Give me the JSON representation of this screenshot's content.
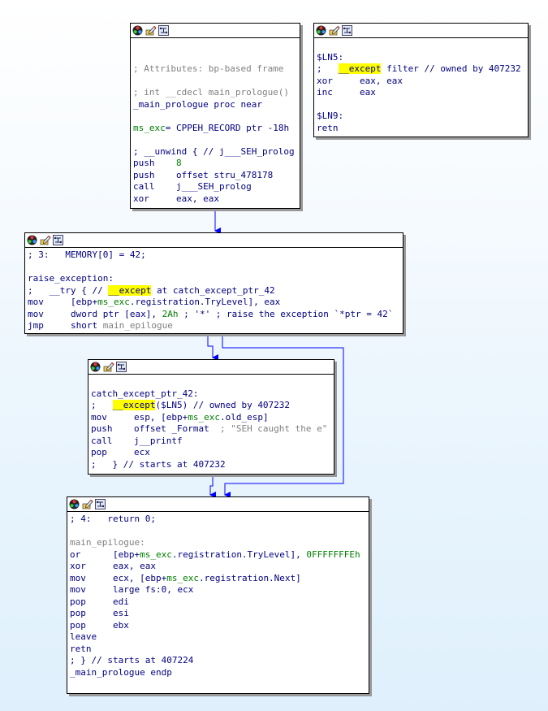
{
  "node_header_icons": [
    "graph-colors-icon",
    "edit-node-icon",
    "node-layout-icon"
  ],
  "colors": {
    "edge": "#0000ff",
    "highlight": "#ffff00",
    "name": "#000080",
    "comment": "#808080",
    "number": "#008000"
  },
  "nodes": [
    {
      "id": "main_prologue",
      "lines": [
        [],
        [],
        [
          {
            "t": "; Attributes: bp-based frame",
            "c": "g"
          }
        ],
        [],
        [
          {
            "t": "; int __cdecl main_prologue()",
            "c": "g"
          }
        ],
        [
          {
            "t": "_main_prologue proc near",
            "c": "nv"
          }
        ],
        [],
        [
          {
            "t": "ms_exc",
            "c": "gr"
          },
          {
            "t": "= CPPEH_RECORD ptr -18h",
            "c": "nv"
          }
        ],
        [],
        [
          {
            "t": "; __unwind { // j___SEH_prolog",
            "c": "nv"
          }
        ],
        [
          {
            "t": "push    ",
            "c": "nv"
          },
          {
            "t": "8",
            "c": "gr"
          }
        ],
        [
          {
            "t": "push    offset stru_478178",
            "c": "nv"
          }
        ],
        [
          {
            "t": "call    j___SEH_prolog",
            "c": "nv"
          }
        ],
        [
          {
            "t": "xor     eax, eax",
            "c": "nv"
          }
        ]
      ]
    },
    {
      "id": "ln5_filter",
      "lines": [
        [],
        [
          {
            "t": "$LN5:",
            "c": "nv"
          }
        ],
        [
          {
            "t": ";   ",
            "c": "nv"
          },
          {
            "t": "__except",
            "c": "hl"
          },
          {
            "t": " filter // owned by 407232",
            "c": "nv"
          }
        ],
        [
          {
            "t": "xor     eax, eax",
            "c": "nv"
          }
        ],
        [
          {
            "t": "inc     eax",
            "c": "nv"
          }
        ],
        [],
        [
          {
            "t": "$LN9:",
            "c": "nv"
          }
        ],
        [
          {
            "t": "retn",
            "c": "nv"
          }
        ]
      ]
    },
    {
      "id": "raise_exception",
      "lines": [
        [
          {
            "t": "; 3:   MEMORY[0] = 42;",
            "c": "nv"
          }
        ],
        [],
        [
          {
            "t": "raise_exception:",
            "c": "nv"
          }
        ],
        [
          {
            "t": ";   __try { // ",
            "c": "nv"
          },
          {
            "t": "__except",
            "c": "hl"
          },
          {
            "t": " at catch_except_ptr_42",
            "c": "nv"
          }
        ],
        [
          {
            "t": "mov     [ebp+",
            "c": "nv"
          },
          {
            "t": "ms_exc",
            "c": "gr"
          },
          {
            "t": ".registration.TryLevel], eax",
            "c": "nv"
          }
        ],
        [
          {
            "t": "mov     dword ptr [eax], ",
            "c": "nv"
          },
          {
            "t": "2Ah",
            "c": "gr"
          },
          {
            "t": " ; '*' ; raise the exception `*ptr = 42`",
            "c": "nv"
          }
        ],
        [
          {
            "t": "jmp     short ",
            "c": "nv"
          },
          {
            "t": "main_epilogue",
            "c": "g"
          }
        ]
      ]
    },
    {
      "id": "catch_except_ptr_42",
      "lines": [
        [],
        [
          {
            "t": "catch_except_ptr_42:",
            "c": "nv"
          }
        ],
        [
          {
            "t": ";   ",
            "c": "nv"
          },
          {
            "t": "__except",
            "c": "hl"
          },
          {
            "t": "($LN5) // owned by 407232",
            "c": "nv"
          }
        ],
        [
          {
            "t": "mov     esp, [ebp+",
            "c": "nv"
          },
          {
            "t": "ms_exc",
            "c": "gr"
          },
          {
            "t": ".old_esp]",
            "c": "nv"
          }
        ],
        [
          {
            "t": "push    offset _Format  ",
            "c": "nv"
          },
          {
            "t": "; \"SEH caught the e\"",
            "c": "g"
          }
        ],
        [
          {
            "t": "call    j__printf",
            "c": "nv"
          }
        ],
        [
          {
            "t": "pop     ecx",
            "c": "nv"
          }
        ],
        [
          {
            "t": ";   } // starts at 407232",
            "c": "nv"
          }
        ]
      ]
    },
    {
      "id": "main_epilogue",
      "lines": [
        [
          {
            "t": "; 4:   return 0;",
            "c": "nv"
          }
        ],
        [],
        [
          {
            "t": "main_epilogue:",
            "c": "g"
          }
        ],
        [
          {
            "t": "or      [ebp+",
            "c": "nv"
          },
          {
            "t": "ms_exc",
            "c": "gr"
          },
          {
            "t": ".registration.TryLevel], ",
            "c": "nv"
          },
          {
            "t": "0FFFFFFFEh",
            "c": "gr"
          }
        ],
        [
          {
            "t": "xor     eax, eax",
            "c": "nv"
          }
        ],
        [
          {
            "t": "mov     ecx, [ebp+",
            "c": "nv"
          },
          {
            "t": "ms_exc",
            "c": "gr"
          },
          {
            "t": ".registration.Next]",
            "c": "nv"
          }
        ],
        [
          {
            "t": "mov     large fs:0, ecx",
            "c": "nv"
          }
        ],
        [
          {
            "t": "pop     edi",
            "c": "nv"
          }
        ],
        [
          {
            "t": "pop     esi",
            "c": "nv"
          }
        ],
        [
          {
            "t": "pop     ebx",
            "c": "nv"
          }
        ],
        [
          {
            "t": "leave",
            "c": "nv"
          }
        ],
        [
          {
            "t": "retn",
            "c": "nv"
          }
        ],
        [
          {
            "t": "; } // starts at 407224",
            "c": "nv"
          }
        ],
        [
          {
            "t": "_main_prologue endp",
            "c": "nv"
          }
        ]
      ]
    }
  ]
}
